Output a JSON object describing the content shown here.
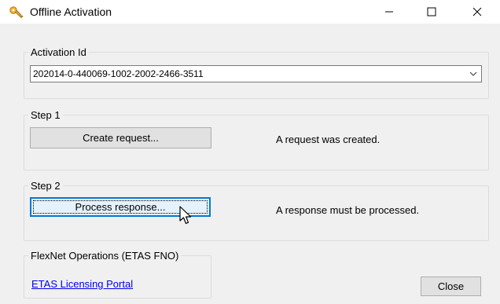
{
  "window": {
    "title": "Offline Activation",
    "controls": {
      "minimize": "minimize-icon",
      "maximize": "maximize-icon",
      "close": "close-icon"
    }
  },
  "activation": {
    "legend": "Activation Id",
    "value": "202014-0-440069-1002-2002-2466-3511"
  },
  "step1": {
    "legend": "Step 1",
    "button_label": "Create request...",
    "status": "A request was created."
  },
  "step2": {
    "legend": "Step 2",
    "button_label": "Process response...",
    "status": "A response must be processed."
  },
  "fno": {
    "legend": "FlexNet Operations (ETAS FNO)",
    "link_label": "ETAS Licensing Portal"
  },
  "footer": {
    "close_label": "Close"
  },
  "colors": {
    "accent": "#0078d7",
    "link": "#0000ee",
    "background": "#f0f0f0"
  },
  "icons": {
    "app": "key-icon",
    "combo": "chevron-down-icon",
    "pointer": "mouse-cursor-icon"
  }
}
